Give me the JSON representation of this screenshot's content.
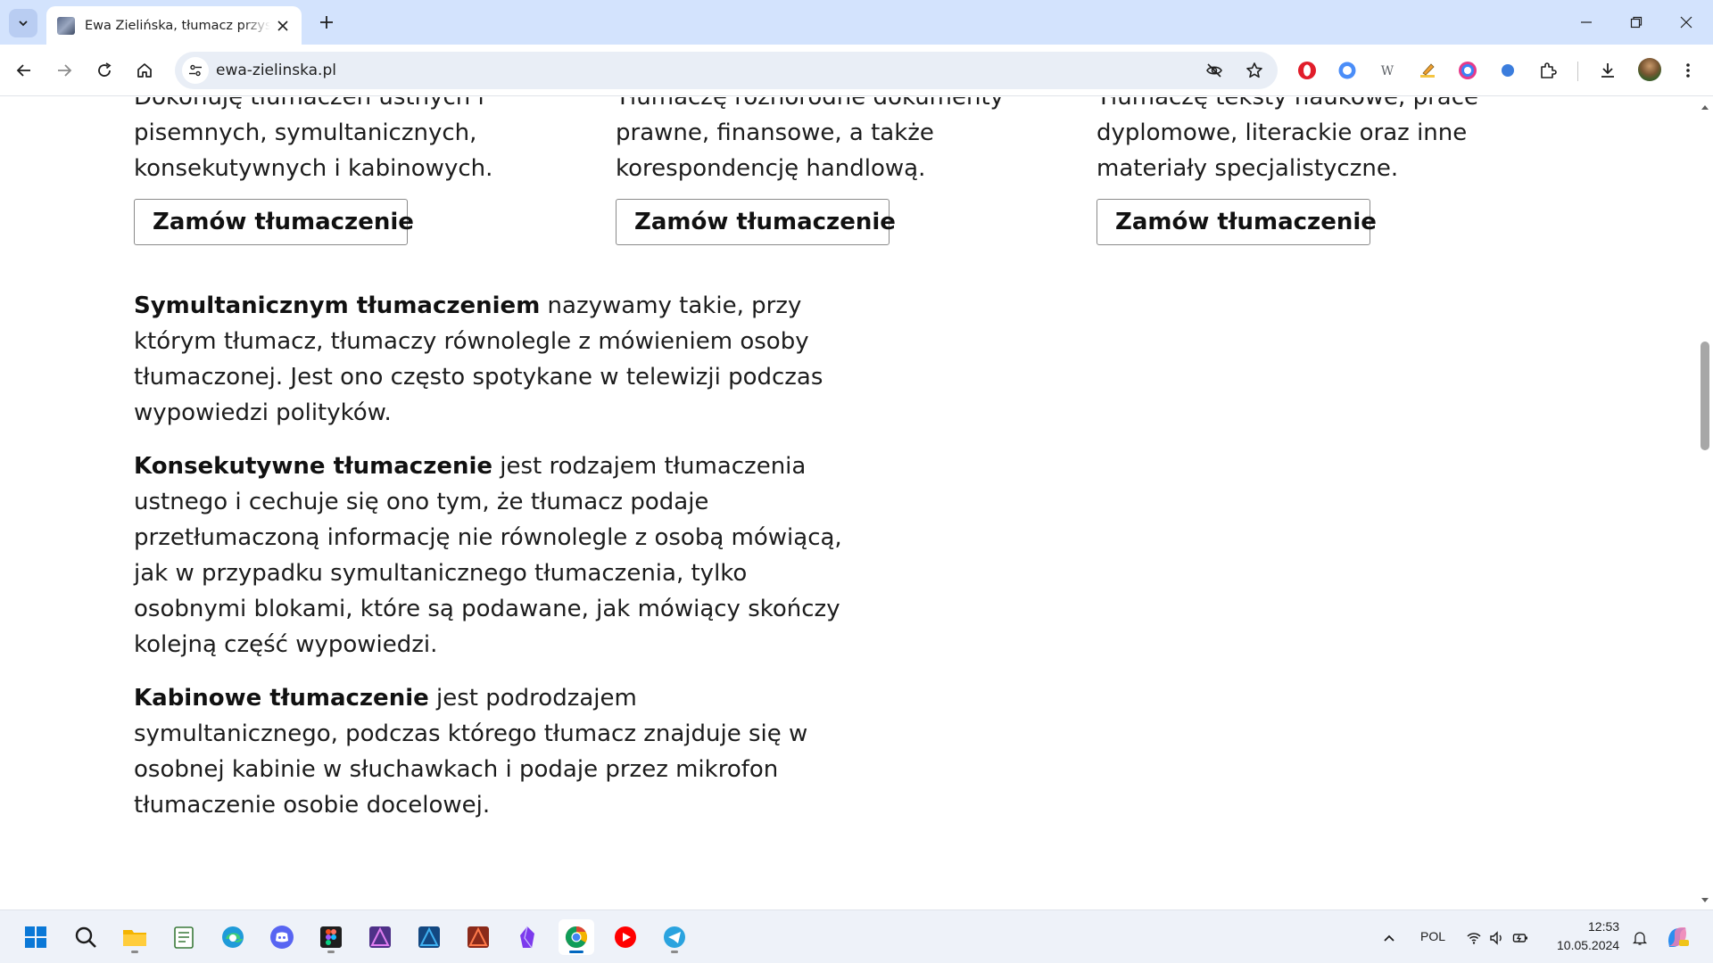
{
  "browser": {
    "tab": {
      "title": "Ewa Zielińska, tłumacz przysięgły"
    },
    "address_bar": {
      "url": "ewa-zielinska.pl"
    }
  },
  "services": [
    {
      "partial_line": "Dokonuję tłumaczeń ustnych i",
      "lines": [
        "pisemnych, symultanicznych,",
        "konsekutywnych i kabinowych."
      ],
      "button_label": "Zamów tłumaczenie"
    },
    {
      "partial_line": "Tłumaczę różnorodne dokumenty",
      "lines": [
        "prawne, finansowe, a także",
        "korespondencję handlową."
      ],
      "button_label": "Zamów tłumaczenie"
    },
    {
      "partial_line": "Tłumaczę teksty naukowe, prace",
      "lines": [
        "dyplomowe, literackie oraz inne",
        "materiały specjalistyczne."
      ],
      "button_label": "Zamów tłumaczenie"
    }
  ],
  "article": [
    {
      "term": "Symultanicznym tłumaczeniem",
      "text": " nazywamy takie, przy którym tłumacz, tłumaczy równolegle z mówieniem osoby tłumaczonej. Jest ono często spotykane w telewizji podczas wypowiedzi polityków."
    },
    {
      "term": "Konsekutywne tłumaczenie",
      "text": " jest rodzajem tłumaczenia ustnego i cechuje się ono tym, że tłumacz podaje przetłumaczoną informację nie równolegle z osobą mówiącą, jak w przypadku symultanicznego tłumaczenia, tylko osobnymi blokami, które są podawane, jak mówiący skończy kolejną część wypowiedzi."
    },
    {
      "term": "Kabinowe tłumaczenie",
      "text": " jest podrodzajem symultanicznego, podczas którego tłumacz znajduje się w osobnej kabinie w słuchawkach i podaje przez mikrofon tłumaczenie osobie docelowej."
    }
  ],
  "taskbar": {
    "apps": [
      "start-icon",
      "search-icon",
      "file-explorer-icon",
      "notepad-icon",
      "edge-icon",
      "discord-icon",
      "figma-icon",
      "affinity-photo-icon",
      "affinity-designer-icon",
      "affinity-publisher-icon",
      "obsidian-icon",
      "chrome-icon",
      "youtube-icon",
      "telegram-icon"
    ],
    "language": "POL",
    "time": "12:53",
    "date": "10.05.2024"
  },
  "colors": {
    "tabstrip": "#d3e3fd",
    "omnibox": "#e9eef6",
    "text": "#1c1c1c",
    "taskbar": "#eef2f9"
  }
}
